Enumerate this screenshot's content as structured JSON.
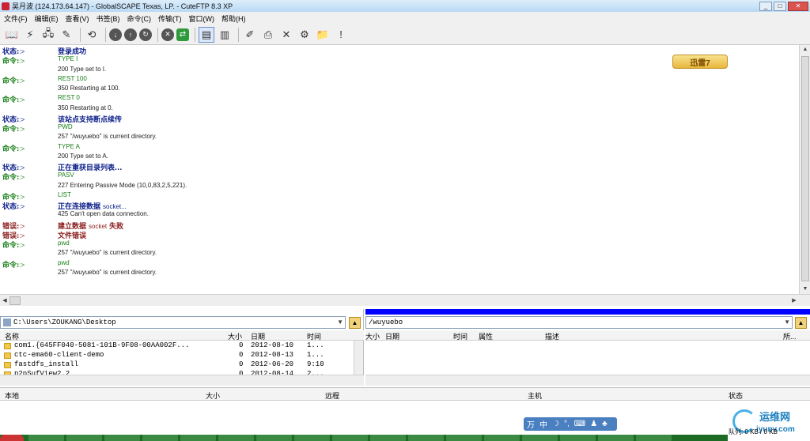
{
  "window": {
    "title": "吴月波 (124.173.64.147) - GlobalSCAPE Texas, LP. - CuteFTP 8.3 XP",
    "buttons": [
      "_",
      "□",
      "✕"
    ]
  },
  "menu": [
    "文件(F)",
    "编辑(E)",
    "查看(V)",
    "书签(B)",
    "命令(C)",
    "传输(T)",
    "窗口(W)",
    "帮助(H)"
  ],
  "toolbar": {
    "icons": [
      "book-icon",
      "quick-connect-icon",
      "site-manager-icon",
      "connect-wizard-icon",
      "reconnect-icon",
      "download-icon",
      "upload-icon",
      "refresh-icon",
      "stop-icon",
      "transfer-icon",
      "view-log-icon",
      "view-list-icon",
      "edit-icon",
      "print-icon",
      "delete-icon",
      "find-icon",
      "new-folder-icon",
      "exclamation-icon"
    ]
  },
  "ad": {
    "label": "迅雷7"
  },
  "log": [
    {
      "type": "status",
      "label": "状态:",
      "msg": "登录成功"
    },
    {
      "type": "cmd",
      "label": "命令:",
      "msg": "TYPE I"
    },
    {
      "type": "resp",
      "label": "",
      "msg": "200 Type set to I."
    },
    {
      "type": "cmd",
      "label": "命令:",
      "msg": "REST 100"
    },
    {
      "type": "resp",
      "label": "",
      "msg": "350 Restarting at 100."
    },
    {
      "type": "cmd",
      "label": "命令:",
      "msg": "REST 0"
    },
    {
      "type": "resp",
      "label": "",
      "msg": "350 Restarting at 0."
    },
    {
      "type": "status",
      "label": "状态:",
      "msg": "该站点支持断点续传"
    },
    {
      "type": "cmd",
      "label": "命令:",
      "msg": "PWD"
    },
    {
      "type": "resp",
      "label": "",
      "msg": "257 \"/wuyuebo\" is current directory."
    },
    {
      "type": "cmd",
      "label": "命令:",
      "msg": "TYPE A"
    },
    {
      "type": "resp",
      "label": "",
      "msg": "200 Type set to A."
    },
    {
      "type": "status",
      "label": "状态:",
      "msg": "正在重获目录列表..."
    },
    {
      "type": "cmd",
      "label": "命令:",
      "msg": "PASV"
    },
    {
      "type": "resp",
      "label": "",
      "msg": "227 Entering Passive Mode (10,0,83,2,5,221)."
    },
    {
      "type": "cmd",
      "label": "命令:",
      "msg": "LIST"
    },
    {
      "type": "status",
      "label": "状态:",
      "msg": "正在连接数据",
      "extra": "socket..."
    },
    {
      "type": "resp",
      "label": "",
      "msg": "425 Can't open data connection."
    },
    {
      "type": "err",
      "label": "错误:",
      "msg": "建立数据",
      "extra": "socket",
      "tail": "失败"
    },
    {
      "type": "err",
      "label": "错误:",
      "msg": "文件错误"
    },
    {
      "type": "cmd",
      "label": "命令:",
      "msg": "pwd"
    },
    {
      "type": "resp",
      "label": "",
      "msg": "257 \"/wuyuebo\" is current directory."
    },
    {
      "type": "cmd",
      "label": "命令:",
      "msg": "pwd"
    },
    {
      "type": "resp",
      "label": "",
      "msg": "257 \"/wuyuebo\" is current directory."
    }
  ],
  "log_arrow": ":>",
  "local": {
    "path": "C:\\Users\\ZOUKANG\\Desktop",
    "columns": [
      "名称",
      "大小",
      "日期",
      "时间"
    ],
    "files": [
      {
        "name": "com1.{645FF040-5081-101B-9F08-00AA002F...",
        "size": "0",
        "date": "2012-08-10",
        "time": "1..."
      },
      {
        "name": "ctc-ema60-client-demo",
        "size": "0",
        "date": "2012-08-13",
        "time": "1..."
      },
      {
        "name": "fastdfs_install",
        "size": "0",
        "date": "2012-06-20",
        "time": "9:10"
      },
      {
        "name": "p2pSufView2.2",
        "size": "0",
        "date": "2012-08-14",
        "time": "2..."
      }
    ]
  },
  "remote": {
    "path": "/wuyuebo",
    "columns": [
      "大小",
      "日期",
      "时间",
      "属性",
      "描述",
      "所..."
    ]
  },
  "queue": {
    "columns": [
      "本地",
      "大小",
      "远程",
      "主机",
      "状态"
    ]
  },
  "ime": [
    "万",
    "中",
    "☽",
    "°,",
    "⌨",
    "♟",
    "♣"
  ],
  "watermark": {
    "title": "运维网",
    "url": "iyunv.com"
  },
  "status_right": "队列: 0 KB / 0 KB"
}
